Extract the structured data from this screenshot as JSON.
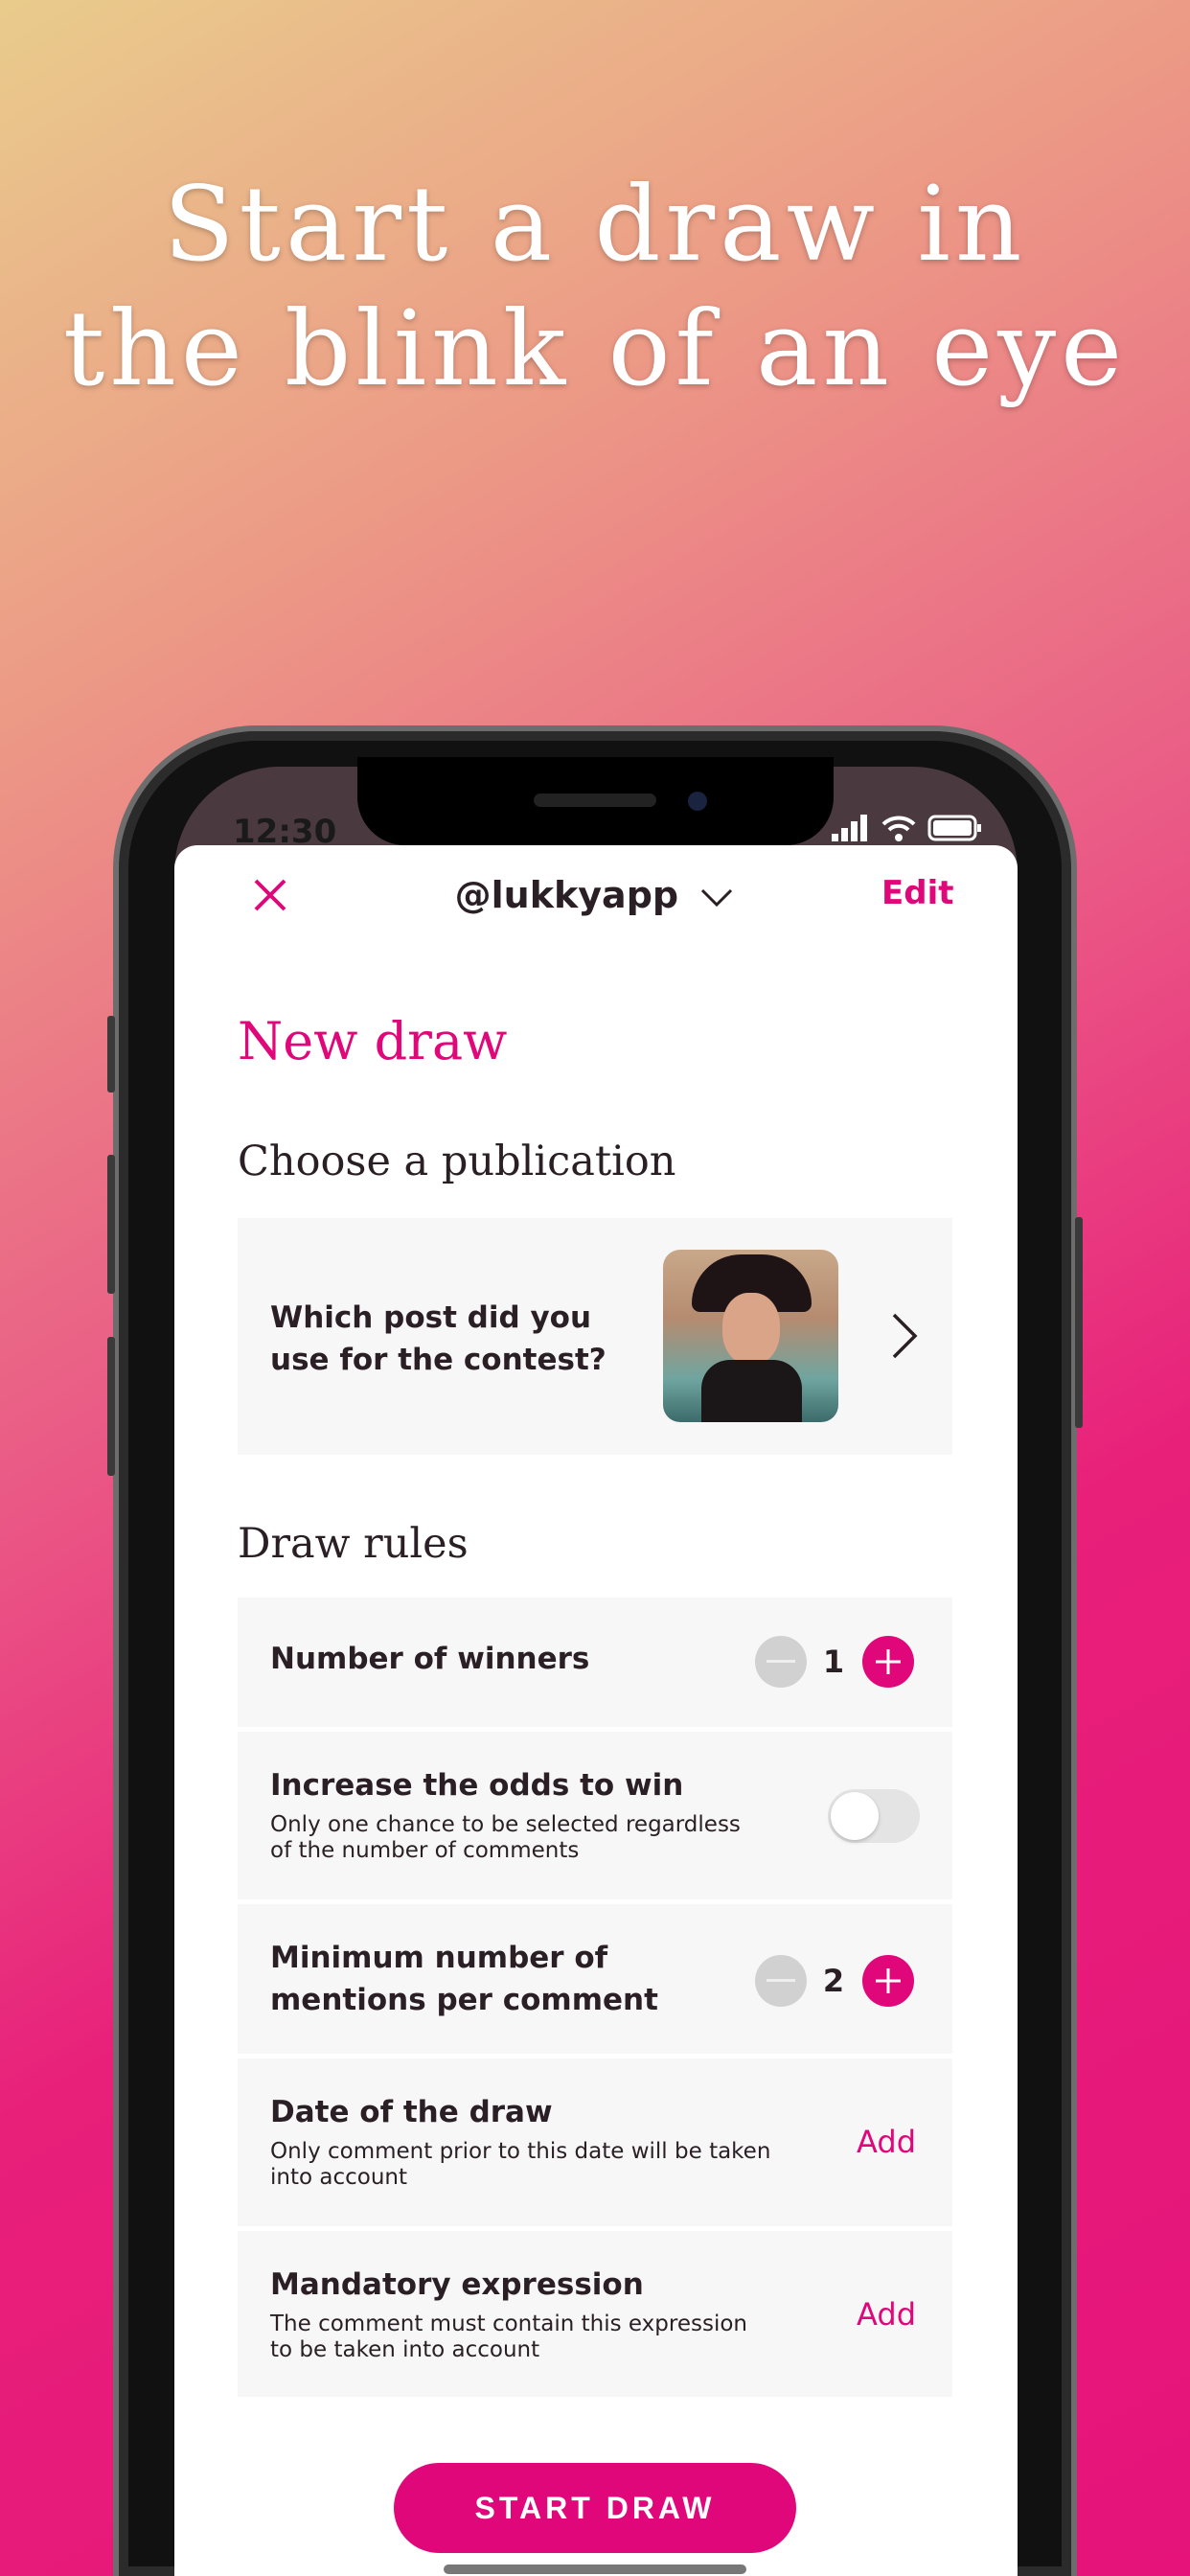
{
  "headline": {
    "line1": "Start a draw in",
    "line2": "the blink of an eye"
  },
  "status_bar": {
    "time": "12:30",
    "icons": [
      "signal-icon",
      "wifi-icon",
      "battery-icon"
    ]
  },
  "header": {
    "close_icon": "close-icon",
    "account": "@lukkyapp",
    "dropdown_icon": "chevron-down-icon",
    "edit_label": "Edit"
  },
  "page_title": "New draw",
  "publication": {
    "heading": "Choose a publication",
    "prompt_line1": "Which post did you",
    "prompt_line2": "use for the contest?",
    "chevron_icon": "chevron-right-icon"
  },
  "rules": {
    "heading": "Draw rules",
    "winners": {
      "title": "Number of winners",
      "value": "1"
    },
    "odds": {
      "title": "Increase the odds to win",
      "sub1": "Only one chance to be selected regardless",
      "sub2": "of the number of comments",
      "enabled": false
    },
    "mentions": {
      "title1": "Minimum number of",
      "title2": "mentions per comment",
      "value": "2"
    },
    "date": {
      "title": "Date of the draw",
      "sub1": "Only comment prior to this date will be taken",
      "sub2": "into account",
      "action": "Add"
    },
    "expression": {
      "title": "Mandatory expression",
      "sub1": "The comment must contain this expression",
      "sub2": "to be taken into account",
      "action": "Add"
    }
  },
  "start_button": "START DRAW",
  "colors": {
    "accent": "#e0077a",
    "text": "#2a1f24",
    "row_bg": "#f7f7f7"
  }
}
